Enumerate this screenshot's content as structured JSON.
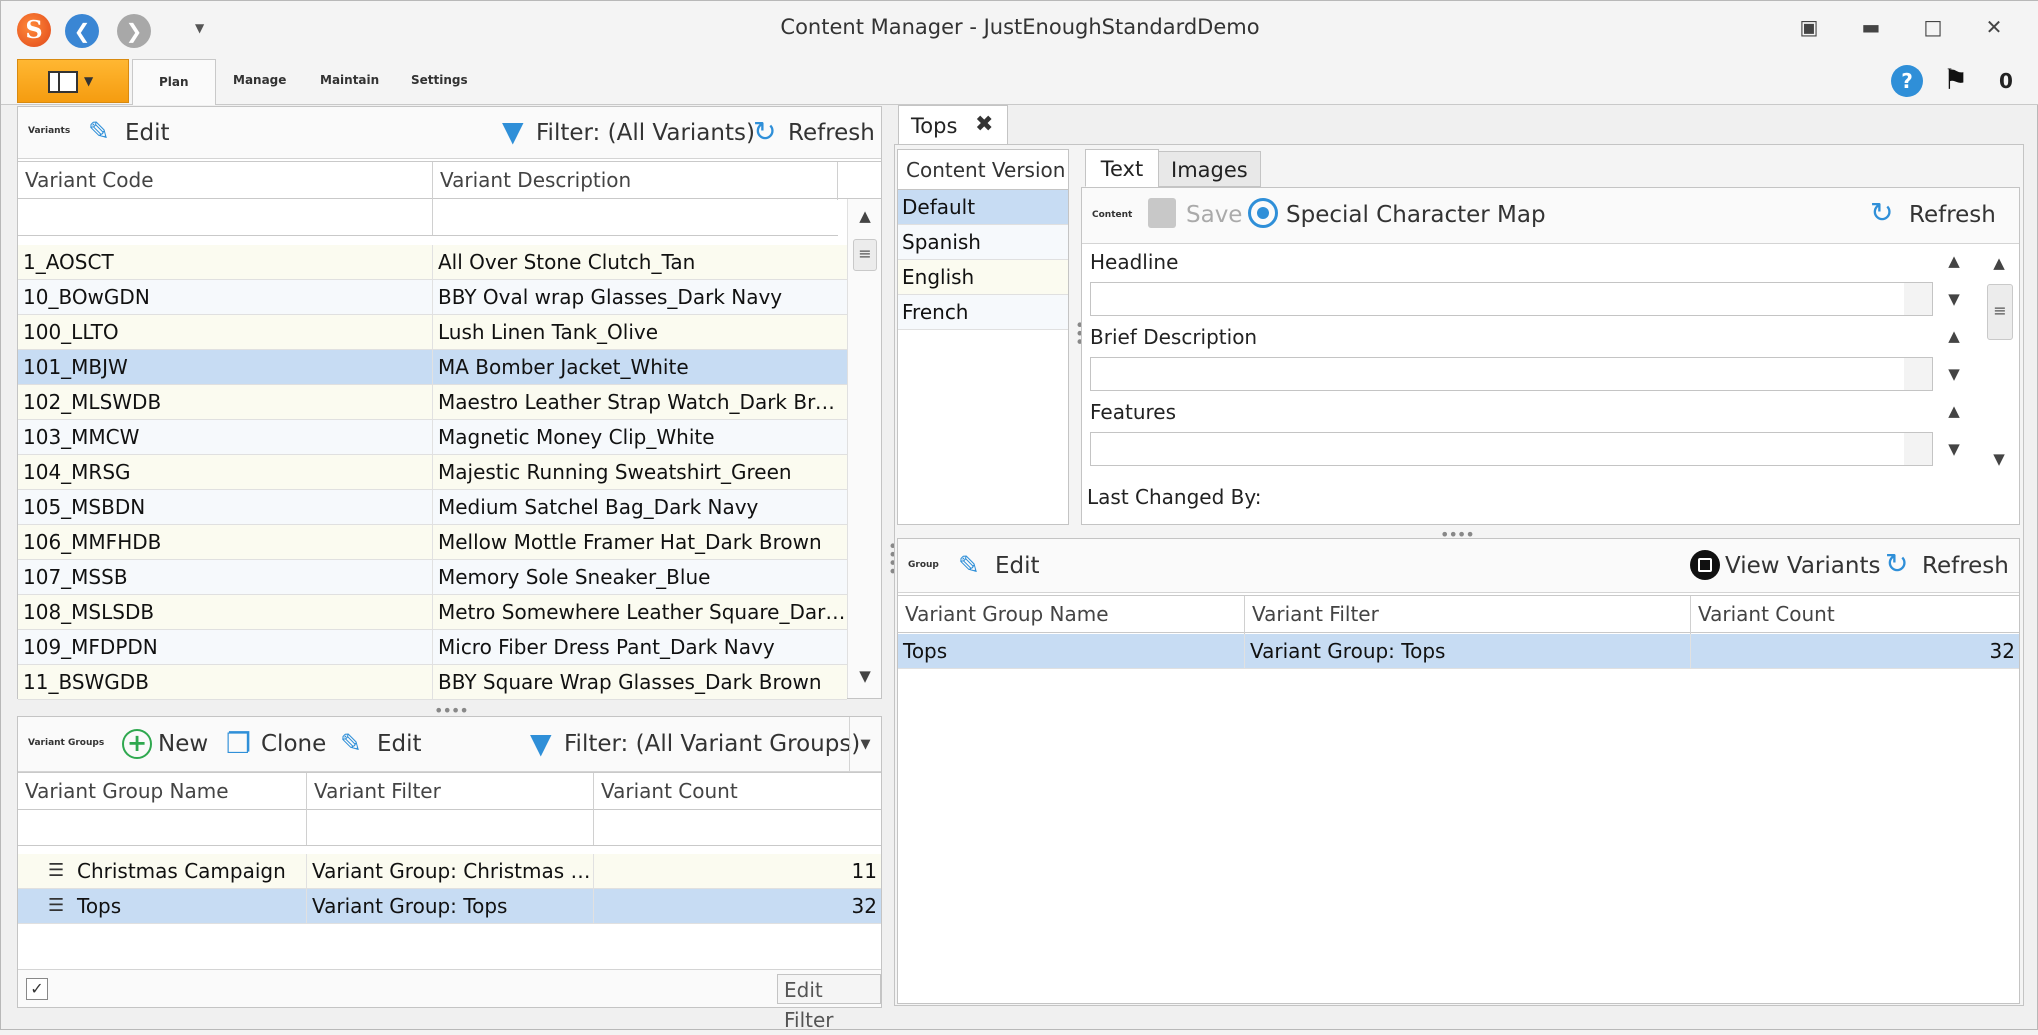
{
  "window": {
    "title": "Content Manager - JustEnoughStandardDemo",
    "notification_count": "0"
  },
  "ribbon": {
    "tabs": [
      "Plan",
      "Manage",
      "Maintain",
      "Settings"
    ]
  },
  "variants": {
    "section_label": "Variants",
    "edit_label": "Edit",
    "filter_label": "Filter: (All Variants)",
    "refresh_label": "Refresh",
    "columns": [
      "Variant Code",
      "Variant Description"
    ],
    "rows": [
      [
        "1_AOSCT",
        "All Over Stone Clutch_Tan"
      ],
      [
        "10_BOwGDN",
        "BBY Oval wrap Glasses_Dark Navy"
      ],
      [
        "100_LLTO",
        "Lush Linen Tank_Olive"
      ],
      [
        "101_MBJW",
        "MA Bomber Jacket_White"
      ],
      [
        "102_MLSWDB",
        "Maestro Leather Strap Watch_Dark Brown"
      ],
      [
        "103_MMCW",
        "Magnetic Money Clip_White"
      ],
      [
        "104_MRSG",
        "Majestic Running Sweatshirt_Green"
      ],
      [
        "105_MSBDN",
        "Medium Satchel Bag_Dark Navy"
      ],
      [
        "106_MMFHDB",
        "Mellow Mottle Framer Hat_Dark Brown"
      ],
      [
        "107_MSSB",
        "Memory Sole Sneaker_Blue"
      ],
      [
        "108_MSLSDB",
        "Metro Somewhere Leather Square_Dark ..."
      ],
      [
        "109_MFDPDN",
        "Micro Fiber Dress Pant_Dark Navy"
      ],
      [
        "11_BSWGDB",
        "BBY Square Wrap Glasses_Dark Brown"
      ]
    ],
    "selected_row": 3
  },
  "variant_groups": {
    "section_label": "Variant Groups",
    "new_label": "New",
    "clone_label": "Clone",
    "edit_label": "Edit",
    "filter_label": "Filter: (All Variant Groups)",
    "columns": [
      "Variant Group Name",
      "Variant Filter",
      "Variant Count"
    ],
    "rows": [
      [
        "Christmas Campaign",
        "Variant Group: Christmas C...",
        "11"
      ],
      [
        "Tops",
        "Variant Group: Tops",
        "32"
      ]
    ],
    "selected_row": 1,
    "edit_filter_label": "Edit Filter"
  },
  "document_tab": {
    "label": "Tops"
  },
  "content_version": {
    "header": "Content Version",
    "items": [
      "Default",
      "Spanish",
      "English",
      "French"
    ],
    "selected_item": 0
  },
  "content_tabs": [
    "Text",
    "Images"
  ],
  "content": {
    "section_label": "Content",
    "save_label": "Save",
    "char_map_label": "Special Character Map",
    "refresh_label": "Refresh",
    "fields": [
      {
        "label": "Headline",
        "value": ""
      },
      {
        "label": "Brief Description",
        "value": ""
      },
      {
        "label": "Features",
        "value": ""
      }
    ],
    "last_changed_label": "Last Changed By:"
  },
  "group": {
    "section_label": "Group",
    "edit_label": "Edit",
    "view_variants_label": "View Variants",
    "refresh_label": "Refresh",
    "columns": [
      "Variant Group Name",
      "Variant Filter",
      "Variant Count"
    ],
    "rows": [
      [
        "Tops",
        "Variant Group: Tops",
        "32"
      ]
    ]
  },
  "colors": {
    "accent_orange": "#f59c10",
    "selection": "#c7dcf3",
    "icon_blue": "#2f8fd8"
  }
}
